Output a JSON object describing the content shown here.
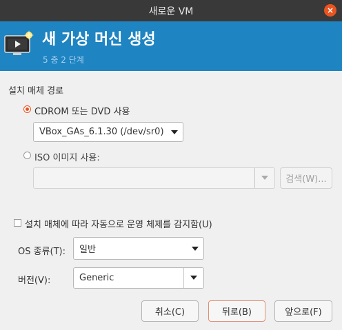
{
  "window": {
    "title": "새로운 VM",
    "close_glyph": "×"
  },
  "header": {
    "title": "새 가상 머신 생성",
    "step": "5 중 2 단계",
    "icon": "monitor-star-icon"
  },
  "install_media": {
    "section_label": "설치 매체 경로",
    "cdrom_option": {
      "label": "CDROM 또는 DVD 사용",
      "selected": true
    },
    "cdrom_device": "VBox_GAs_6.1.30 (/dev/sr0)",
    "iso_option": {
      "label": "ISO 이미지 사용:",
      "selected": false
    },
    "iso_path": "",
    "browse_label": "검색(W)..."
  },
  "os_detect": {
    "label": "설치 매체에 따라 자동으로 운영 체제를 감지함(U)",
    "checked": false
  },
  "os_type": {
    "label": "OS 종류(T):",
    "value": "일반"
  },
  "version": {
    "label": "버전(V):",
    "value": "Generic"
  },
  "buttons": {
    "cancel": "취소(C)",
    "back": "뒤로(B)",
    "forward": "앞으로(F)"
  },
  "colors": {
    "header_bg": "#1e84c2",
    "accent": "#e95420",
    "titlebar_bg": "#393939"
  }
}
